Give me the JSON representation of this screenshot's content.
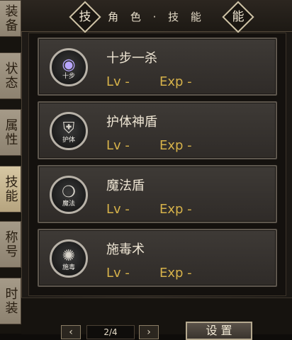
{
  "tabs": [
    {
      "label": "装备"
    },
    {
      "label": "状态"
    },
    {
      "label": "属性"
    },
    {
      "label": "技能"
    },
    {
      "label": "称号"
    },
    {
      "label": "时装"
    }
  ],
  "header": {
    "title": "角 色 · 技 能",
    "badge_left": "技",
    "badge_right": "能"
  },
  "skills": [
    {
      "name": "十步一杀",
      "icon_label": "十步",
      "icon": "purple-orb-icon",
      "lv": "Lv -",
      "exp": "Exp -"
    },
    {
      "name": "护体神盾",
      "icon_label": "护体",
      "icon": "shield-icon",
      "lv": "Lv -",
      "exp": "Exp -"
    },
    {
      "name": "魔法盾",
      "icon_label": "魔法",
      "icon": "magic-shield-icon",
      "lv": "Lv -",
      "exp": "Exp -"
    },
    {
      "name": "施毒术",
      "icon_label": "施毒",
      "icon": "poison-icon",
      "lv": "Lv -",
      "exp": "Exp -"
    }
  ],
  "pagination": {
    "current": "2/4",
    "prev_symbol": "‹",
    "next_symbol": "›"
  },
  "buttons": {
    "settings_label": "设 置"
  }
}
